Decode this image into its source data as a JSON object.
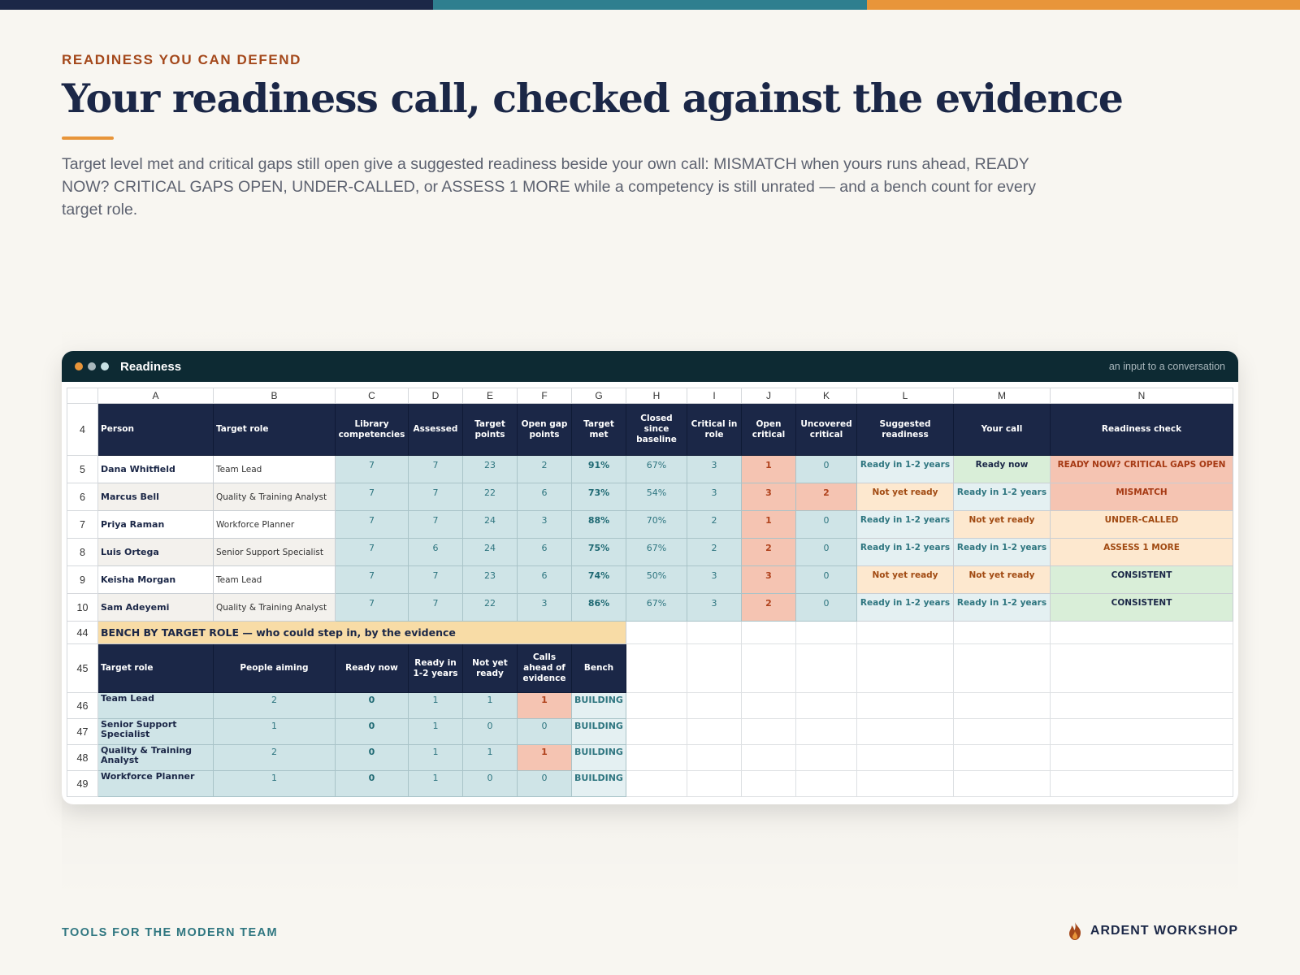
{
  "colors": {
    "navy": "#1b2747",
    "teal": "#2f7680",
    "orange": "#e8953a",
    "rust": "#a4481b"
  },
  "eyebrow": "READINESS YOU CAN DEFEND",
  "title": "Your readiness call, checked against the evidence",
  "lede": "Target level met and critical gaps still open give a suggested readiness beside your own call: MISMATCH when yours runs ahead, READY NOW? CRITICAL GAPS OPEN, UNDER-CALLED, or ASSESS 1 MORE while a competency is still unrated — and a bench count for every target role.",
  "window": {
    "title": "Readiness",
    "note": "an input to a conversation"
  },
  "sheet": {
    "columns": [
      "A",
      "B",
      "C",
      "D",
      "E",
      "F",
      "G",
      "H",
      "I",
      "J",
      "K",
      "L",
      "M",
      "N"
    ],
    "header_row": "4",
    "headers": [
      "Person",
      "Target role",
      "Library competencies",
      "Assessed",
      "Target points",
      "Open gap points",
      "Target met",
      "Closed since baseline",
      "Critical in role",
      "Open critical",
      "Uncovered critical",
      "Suggested readiness",
      "Your call",
      "Readiness check"
    ],
    "rows": [
      {
        "row": "5",
        "person": "Dana Whitfield",
        "role": "Team Lead",
        "library": "7",
        "assessed": "7",
        "target_points": "23",
        "open_gap": "2",
        "target_met": "91%",
        "closed": "67%",
        "critical": "3",
        "open_critical": "1",
        "uncovered": "0",
        "suggested": "Ready in 1-2 years",
        "your_call": "Ready now",
        "check": "READY NOW? CRITICAL GAPS OPEN"
      },
      {
        "row": "6",
        "person": "Marcus Bell",
        "role": "Quality & Training Analyst",
        "library": "7",
        "assessed": "7",
        "target_points": "22",
        "open_gap": "6",
        "target_met": "73%",
        "closed": "54%",
        "critical": "3",
        "open_critical": "3",
        "uncovered": "2",
        "suggested": "Not yet ready",
        "your_call": "Ready in 1-2 years",
        "check": "MISMATCH"
      },
      {
        "row": "7",
        "person": "Priya Raman",
        "role": "Workforce Planner",
        "library": "7",
        "assessed": "7",
        "target_points": "24",
        "open_gap": "3",
        "target_met": "88%",
        "closed": "70%",
        "critical": "2",
        "open_critical": "1",
        "uncovered": "0",
        "suggested": "Ready in 1-2 years",
        "your_call": "Not yet ready",
        "check": "UNDER-CALLED"
      },
      {
        "row": "8",
        "person": "Luis Ortega",
        "role": "Senior Support Specialist",
        "library": "7",
        "assessed": "6",
        "target_points": "24",
        "open_gap": "6",
        "target_met": "75%",
        "closed": "67%",
        "critical": "2",
        "open_critical": "2",
        "uncovered": "0",
        "suggested": "Ready in 1-2 years",
        "your_call": "Ready in 1-2 years",
        "check": "ASSESS 1 MORE"
      },
      {
        "row": "9",
        "person": "Keisha Morgan",
        "role": "Team Lead",
        "library": "7",
        "assessed": "7",
        "target_points": "23",
        "open_gap": "6",
        "target_met": "74%",
        "closed": "50%",
        "critical": "3",
        "open_critical": "3",
        "uncovered": "0",
        "suggested": "Not yet ready",
        "your_call": "Not yet ready",
        "check": "CONSISTENT"
      },
      {
        "row": "10",
        "person": "Sam Adeyemi",
        "role": "Quality & Training Analyst",
        "library": "7",
        "assessed": "7",
        "target_points": "22",
        "open_gap": "3",
        "target_met": "86%",
        "closed": "67%",
        "critical": "3",
        "open_critical": "2",
        "uncovered": "0",
        "suggested": "Ready in 1-2 years",
        "your_call": "Ready in 1-2 years",
        "check": "CONSISTENT"
      }
    ],
    "band_row": "44",
    "band_label": "BENCH BY TARGET ROLE  —  who could step in, by the evidence",
    "bench_header_row": "45",
    "bench_headers": [
      "Target role",
      "People aiming",
      "Ready now",
      "Ready in 1-2 years",
      "Not yet ready",
      "Calls ahead of evidence",
      "Bench"
    ],
    "bench_rows": [
      {
        "row": "46",
        "role": "Team Lead",
        "aiming": "2",
        "ready_now": "0",
        "ready_1_2": "1",
        "not_yet": "1",
        "ahead": "1",
        "bench": "BUILDING"
      },
      {
        "row": "47",
        "role": "Senior Support Specialist",
        "aiming": "1",
        "ready_now": "0",
        "ready_1_2": "1",
        "not_yet": "0",
        "ahead": "0",
        "bench": "BUILDING"
      },
      {
        "row": "48",
        "role": "Quality & Training Analyst",
        "aiming": "2",
        "ready_now": "0",
        "ready_1_2": "1",
        "not_yet": "1",
        "ahead": "1",
        "bench": "BUILDING"
      },
      {
        "row": "49",
        "role": "Workforce Planner",
        "aiming": "1",
        "ready_now": "0",
        "ready_1_2": "1",
        "not_yet": "0",
        "ahead": "0",
        "bench": "BUILDING"
      }
    ]
  },
  "footer": {
    "tagline": "TOOLS FOR THE MODERN TEAM",
    "brand": "ARDENT WORKSHOP",
    "brand_icon": "flame-icon"
  }
}
